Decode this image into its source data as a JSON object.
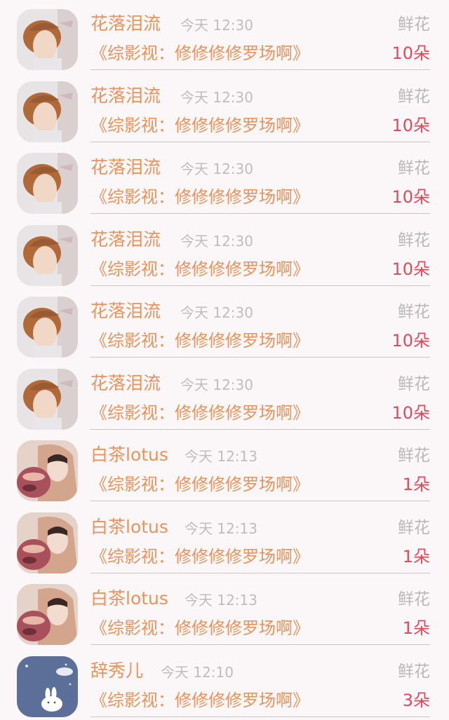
{
  "rows": [
    {
      "name": "花落泪流",
      "time": "今天 12:30",
      "gift": "鲜花",
      "book": "《综影视：修修修修罗场啊》",
      "count": "10朵",
      "avatar": "boy-avatar"
    },
    {
      "name": "花落泪流",
      "time": "今天 12:30",
      "gift": "鲜花",
      "book": "《综影视：修修修修罗场啊》",
      "count": "10朵",
      "avatar": "boy-avatar"
    },
    {
      "name": "花落泪流",
      "time": "今天 12:30",
      "gift": "鲜花",
      "book": "《综影视：修修修修罗场啊》",
      "count": "10朵",
      "avatar": "boy-avatar"
    },
    {
      "name": "花落泪流",
      "time": "今天 12:30",
      "gift": "鲜花",
      "book": "《综影视：修修修修罗场啊》",
      "count": "10朵",
      "avatar": "boy-avatar"
    },
    {
      "name": "花落泪流",
      "time": "今天 12:30",
      "gift": "鲜花",
      "book": "《综影视：修修修修罗场啊》",
      "count": "10朵",
      "avatar": "boy-avatar"
    },
    {
      "name": "花落泪流",
      "time": "今天 12:30",
      "gift": "鲜花",
      "book": "《综影视：修修修修罗场啊》",
      "count": "10朵",
      "avatar": "boy-avatar"
    },
    {
      "name": "白茶lotus",
      "time": "今天 12:13",
      "gift": "鲜花",
      "book": "《综影视：修修修修罗场啊》",
      "count": "1朵",
      "avatar": "hooded-avatar"
    },
    {
      "name": "白茶lotus",
      "time": "今天 12:13",
      "gift": "鲜花",
      "book": "《综影视：修修修修罗场啊》",
      "count": "1朵",
      "avatar": "hooded-avatar"
    },
    {
      "name": "白茶lotus",
      "time": "今天 12:13",
      "gift": "鲜花",
      "book": "《综影视：修修修修罗场啊》",
      "count": "1朵",
      "avatar": "hooded-avatar"
    },
    {
      "name": "辞秀儿",
      "time": "今天 12:10",
      "gift": "鲜花",
      "book": "《综影视：修修修修罗场啊》",
      "count": "3朵",
      "avatar": "moon-rabbit-avatar"
    }
  ],
  "colors": {
    "background": "#fbf7f8",
    "name": "#e9935c",
    "time": "#bdbdbd",
    "gift": "#b8b8b8",
    "count": "#df4a5d",
    "divider": "#c6c6c6"
  }
}
